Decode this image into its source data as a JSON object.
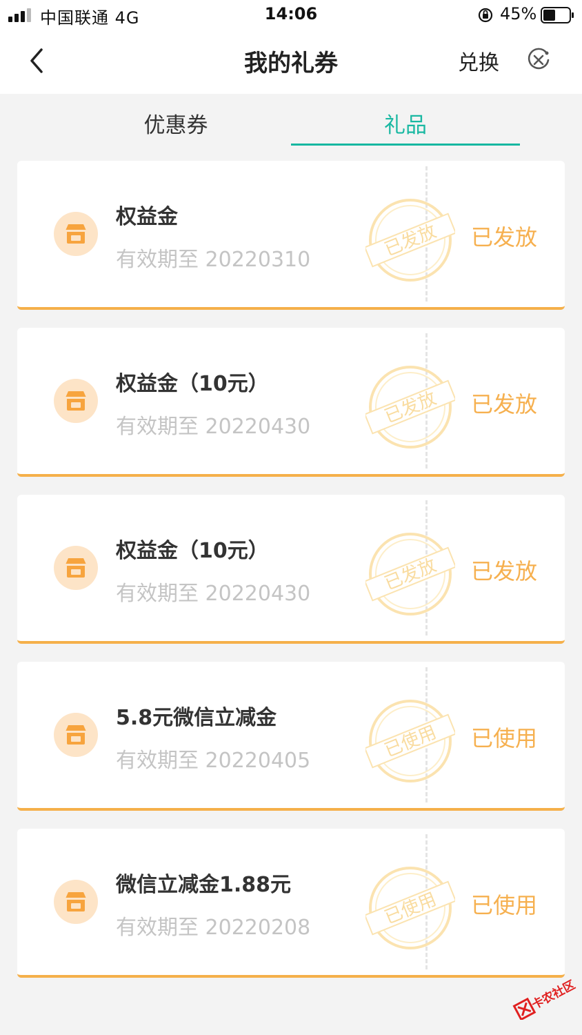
{
  "status_bar": {
    "carrier": "中国联通  4G",
    "time": "14:06",
    "battery": "45%"
  },
  "nav": {
    "title": "我的礼券",
    "exchange_label": "兑换",
    "back_icon": "chevron-left-icon",
    "close_icon": "close-circle-icon"
  },
  "tabs": [
    {
      "label": "优惠券",
      "active": false
    },
    {
      "label": "礼品",
      "active": true
    }
  ],
  "colors": {
    "accent": "#16b7a0",
    "status_orange": "#f6b04f",
    "card_border": "#f5b04a"
  },
  "cards": [
    {
      "name": "权益金",
      "expiry": "有效期至 20220310",
      "stamp": "已发放",
      "status": "已发放"
    },
    {
      "name": "权益金（10元）",
      "expiry": "有效期至 20220430",
      "stamp": "已发放",
      "status": "已发放"
    },
    {
      "name": "权益金（10元）",
      "expiry": "有效期至 20220430",
      "stamp": "已发放",
      "status": "已发放"
    },
    {
      "name": "5.8元微信立减金",
      "expiry": "有效期至 20220405",
      "stamp": "已使用",
      "status": "已使用"
    },
    {
      "name": "微信立减金1.88元",
      "expiry": "有效期至 20220208",
      "stamp": "已使用",
      "status": "已使用"
    }
  ],
  "watermark": "卡农社区"
}
